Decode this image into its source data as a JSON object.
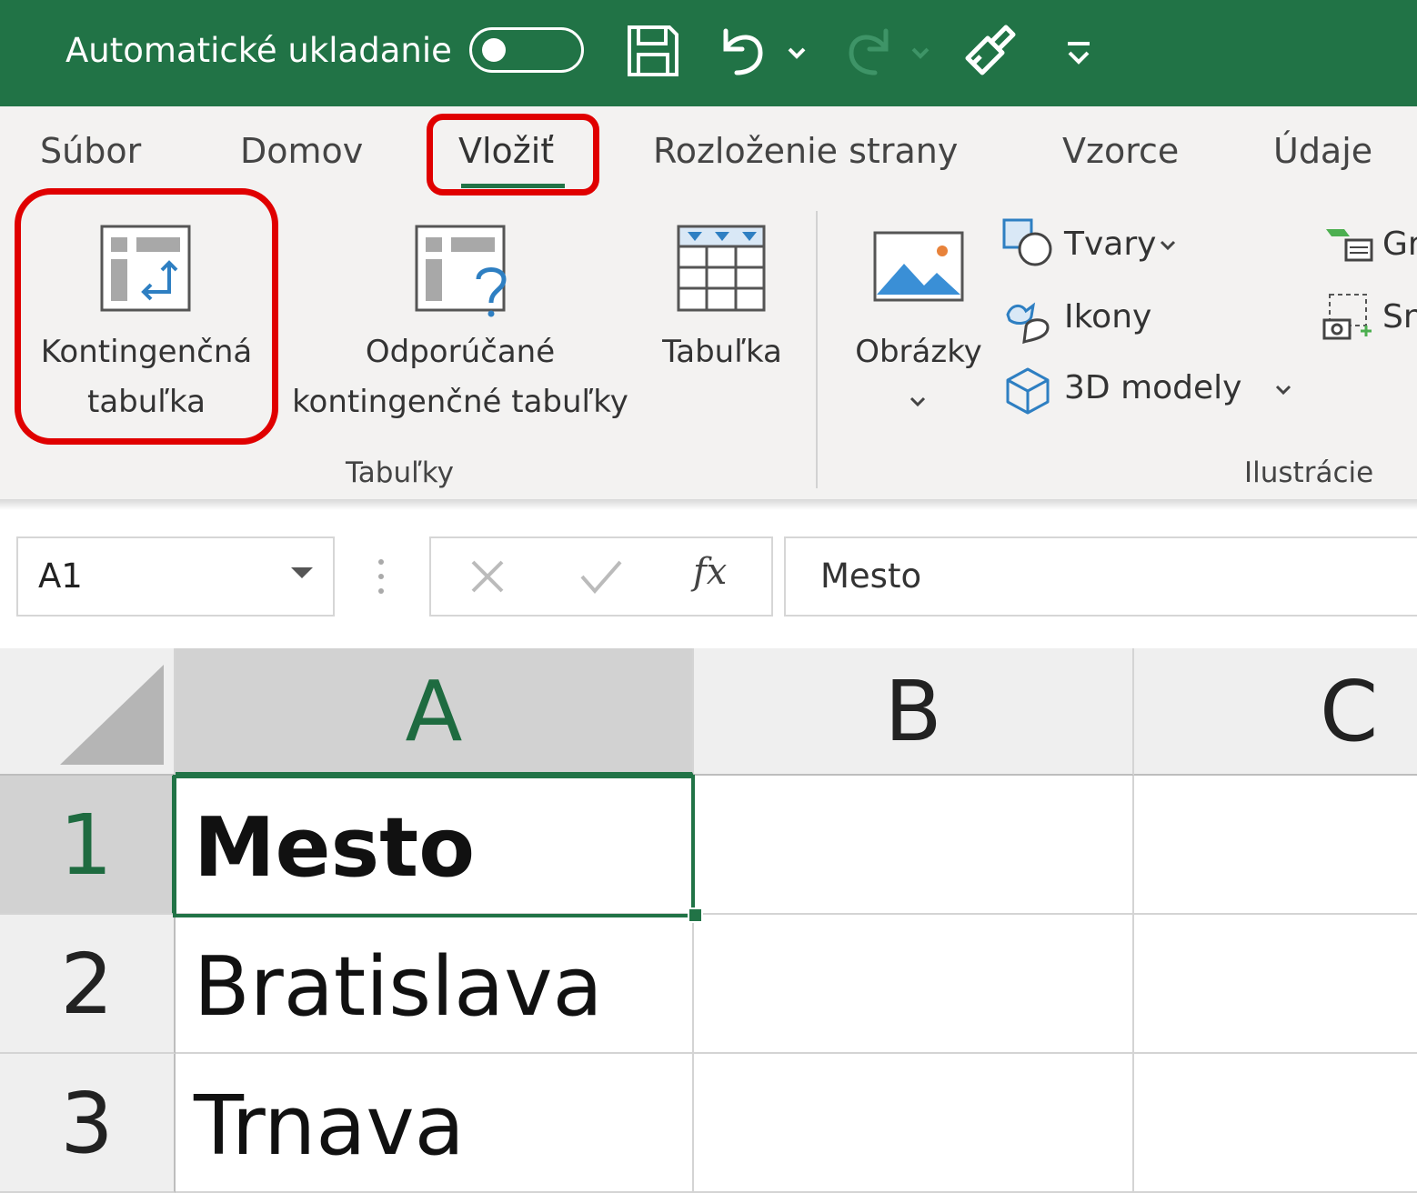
{
  "title_bar": {
    "autosave_label": "Automatické ukladanie",
    "autosave_state": "off",
    "background_color": "#217346",
    "quick_access": [
      {
        "name": "save-icon"
      },
      {
        "name": "undo-icon"
      },
      {
        "name": "redo-icon"
      },
      {
        "name": "format-painter-icon"
      },
      {
        "name": "customize-qat-icon"
      }
    ]
  },
  "ribbon": {
    "tabs": [
      {
        "label": "Súbor"
      },
      {
        "label": "Domov"
      },
      {
        "label": "Vložiť",
        "active": true
      },
      {
        "label": "Rozloženie strany"
      },
      {
        "label": "Vzorce"
      },
      {
        "label": "Údaje"
      }
    ],
    "groups": {
      "tables": {
        "label": "Tabuľky",
        "pivot_line1": "Kontingenčná",
        "pivot_line2": "tabuľka",
        "recommended_line1": "Odporúčané",
        "recommended_line2": "kontingenčné tabuľky",
        "table_label": "Tabuľka"
      },
      "illustrations": {
        "label": "Ilustrácie",
        "pictures_label": "Obrázky",
        "shapes_label": "Tvary",
        "icons_label": "Ikony",
        "models_label": "3D modely",
        "cut_label_1": "Gr",
        "cut_label_2": "Sn"
      }
    },
    "highlight_color": "#e00000"
  },
  "formula_bar": {
    "name_box": "A1",
    "formula": "Mesto",
    "fx_label": "fx"
  },
  "grid": {
    "columns": [
      "A",
      "B",
      "C"
    ],
    "rows": [
      {
        "num": "1",
        "a": "Mesto",
        "bold": true
      },
      {
        "num": "2",
        "a": "Bratislava"
      },
      {
        "num": "3",
        "a": "Trnava"
      }
    ],
    "selected_cell": "A1",
    "accent_color": "#217346"
  }
}
